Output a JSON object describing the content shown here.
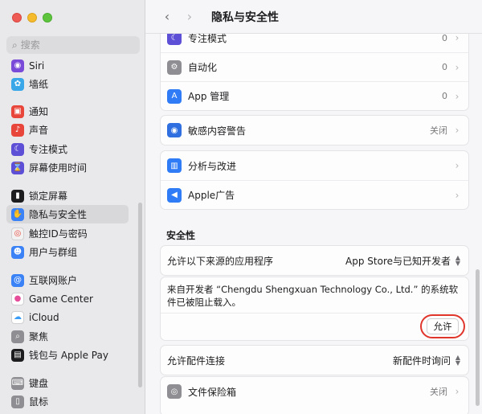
{
  "window": {
    "title": "隐私与安全性"
  },
  "sidebar": {
    "search_placeholder": "搜索",
    "items": [
      {
        "label": "Siri",
        "icon": "siri-icon",
        "color": "#7a4ad8"
      },
      {
        "label": "墙纸",
        "icon": "wallpaper-icon",
        "color": "#39a7e8"
      },
      {
        "label": "通知",
        "icon": "notification-icon",
        "color": "#e8463b"
      },
      {
        "label": "声音",
        "icon": "sound-icon",
        "color": "#e8463b"
      },
      {
        "label": "专注模式",
        "icon": "focus-icon",
        "color": "#5d4fd6"
      },
      {
        "label": "屏幕使用时间",
        "icon": "screen-time-icon",
        "color": "#5d4fd6"
      },
      {
        "label": "锁定屏幕",
        "icon": "lock-icon",
        "color": "#1d1d1f"
      },
      {
        "label": "隐私与安全性",
        "icon": "hand-icon",
        "color": "#3a82f6",
        "selected": true
      },
      {
        "label": "触控ID与密码",
        "icon": "fingerprint-icon",
        "color": "#f2f2f2"
      },
      {
        "label": "用户与群组",
        "icon": "users-icon",
        "color": "#3a82f6"
      },
      {
        "label": "互联网账户",
        "icon": "at-icon",
        "color": "#3a82f6"
      },
      {
        "label": "Game Center",
        "icon": "game-center-icon",
        "color": "#ffffff"
      },
      {
        "label": "iCloud",
        "icon": "cloud-icon",
        "color": "#ffffff"
      },
      {
        "label": "聚焦",
        "icon": "spotlight-icon",
        "color": "#8e8e93"
      },
      {
        "label": "钱包与 Apple Pay",
        "icon": "wallet-icon",
        "color": "#1d1d1f"
      },
      {
        "label": "键盘",
        "icon": "keyboard-icon",
        "color": "#8e8e93"
      },
      {
        "label": "鼠标",
        "icon": "mouse-icon",
        "color": "#8e8e93"
      }
    ]
  },
  "main": {
    "rows_top": [
      {
        "label": "专注模式",
        "value": "0",
        "icon": "focus-icon",
        "color": "#5d4fd6"
      },
      {
        "label": "自动化",
        "value": "0",
        "icon": "gears-icon",
        "color": "#8e8e93"
      },
      {
        "label": "App 管理",
        "value": "0",
        "icon": "app-store-icon",
        "color": "#2f7cf6"
      }
    ],
    "rows_sensitive": [
      {
        "label": "敏感内容警告",
        "value": "关闭",
        "icon": "eye-icon",
        "color": "#2f6fe0"
      }
    ],
    "rows_analytics": [
      {
        "label": "分析与改进",
        "value": "",
        "icon": "chart-icon",
        "color": "#2f7cf6"
      },
      {
        "label": "Apple广告",
        "value": "",
        "icon": "megaphone-icon",
        "color": "#2f7cf6"
      }
    ],
    "security": {
      "section_title": "安全性",
      "allow_from_label": "允许以下来源的应用程序",
      "allow_from_value": "App Store与已知开发者",
      "blocked_message": "来自开发者 “Chengdu Shengxuan Technology Co., Ltd.” 的系统软件已被阻止载入。",
      "allow_button": "允许",
      "accessories_label": "允许配件连接",
      "accessories_value": "新配件时询问",
      "filevault_label": "文件保险箱",
      "filevault_value": "关闭"
    }
  }
}
